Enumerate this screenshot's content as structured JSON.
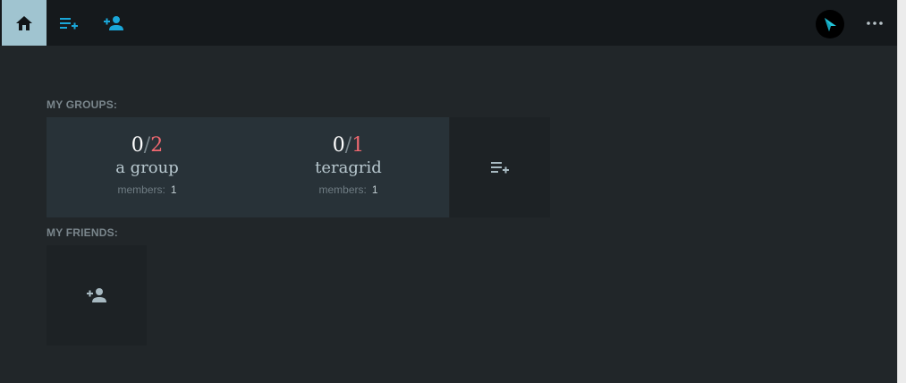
{
  "toolbar": {
    "home_icon": "home-icon",
    "new_group_icon": "playlist-add-icon",
    "add_friend_icon": "person-add-icon",
    "avatar_icon": "arrow-logo-icon",
    "more_icon": "more-horizontal-icon",
    "active_color": "#a0c4d0",
    "accent_color": "#1aa7d9"
  },
  "groups": {
    "label": "MY GROUPS:",
    "items": [
      {
        "active": "0",
        "sep": "/",
        "total": "2",
        "name": "a group",
        "members_label": "members:",
        "members_value": "1"
      },
      {
        "active": "0",
        "sep": "/",
        "total": "1",
        "name": "teragrid",
        "members_label": "members:",
        "members_value": "1"
      }
    ],
    "add_icon": "playlist-add-icon"
  },
  "friends": {
    "label": "MY FRIENDS:",
    "add_icon": "person-add-icon"
  },
  "colors": {
    "total_count": "#f06870",
    "background": "#212629",
    "panel": "#283238"
  }
}
